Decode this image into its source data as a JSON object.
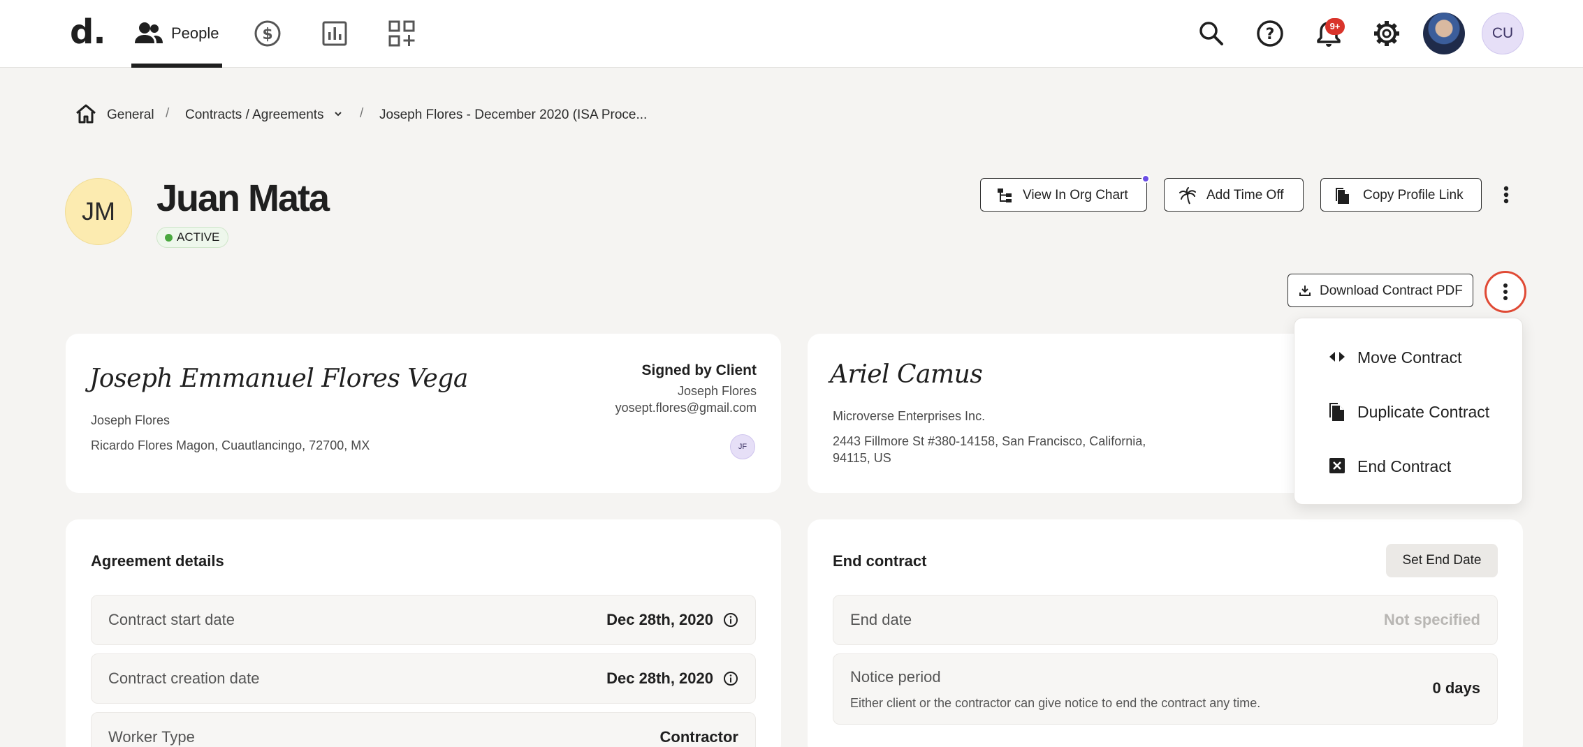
{
  "topbar": {
    "logo": "d.",
    "nav_people_label": "People",
    "notification_count": "9+",
    "user_initials": "CU"
  },
  "breadcrumb": {
    "home": "General",
    "section": "Contracts / Agreements",
    "current": "Joseph Flores - December 2020 (ISA Proce..."
  },
  "profile": {
    "initials": "JM",
    "name": "Juan Mata",
    "status": "ACTIVE",
    "status_color": "#4aa83f"
  },
  "actions": {
    "org_chart": "View In Org Chart",
    "time_off": "Add Time Off",
    "copy_link": "Copy Profile Link",
    "download_pdf": "Download Contract PDF"
  },
  "menu": {
    "items": [
      {
        "label": "Move Contract",
        "icon": "move-icon"
      },
      {
        "label": "Duplicate Contract",
        "icon": "duplicate-icon"
      },
      {
        "label": "End Contract",
        "icon": "close-box-icon"
      }
    ]
  },
  "contractor_card": {
    "signature": "Joseph Emmanuel Flores Vega",
    "name": "Joseph Flores",
    "address": "Ricardo Flores Magon, Cuautlancingo, 72700, MX",
    "signed_title": "Signed by Client",
    "signed_name": "Joseph Flores",
    "signed_email": "yosept.flores@gmail.com",
    "signer_initials": "JF"
  },
  "client_card": {
    "signature": "Ariel Camus",
    "company": "Microverse Enterprises Inc.",
    "address_line1": "2443 Fillmore St #380-14158, San Francisco, California,",
    "address_line2": "94115, US"
  },
  "agreement": {
    "title": "Agreement details",
    "rows": [
      {
        "label": "Contract start date",
        "value": "Dec 28th, 2020"
      },
      {
        "label": "Contract creation date",
        "value": "Dec 28th, 2020"
      },
      {
        "label": "Worker Type",
        "value": "Contractor"
      }
    ]
  },
  "end_contract": {
    "title": "End contract",
    "set_end_date": "Set End Date",
    "end_date_label": "End date",
    "end_date_value": "Not specified",
    "notice_label": "Notice period",
    "notice_desc": "Either client or the contractor can give notice to end the contract any time.",
    "notice_value": "0 days"
  },
  "colors": {
    "accent_ring": "#e04a35",
    "notification": "#d9342b",
    "org_dot": "#6b4ee6"
  }
}
